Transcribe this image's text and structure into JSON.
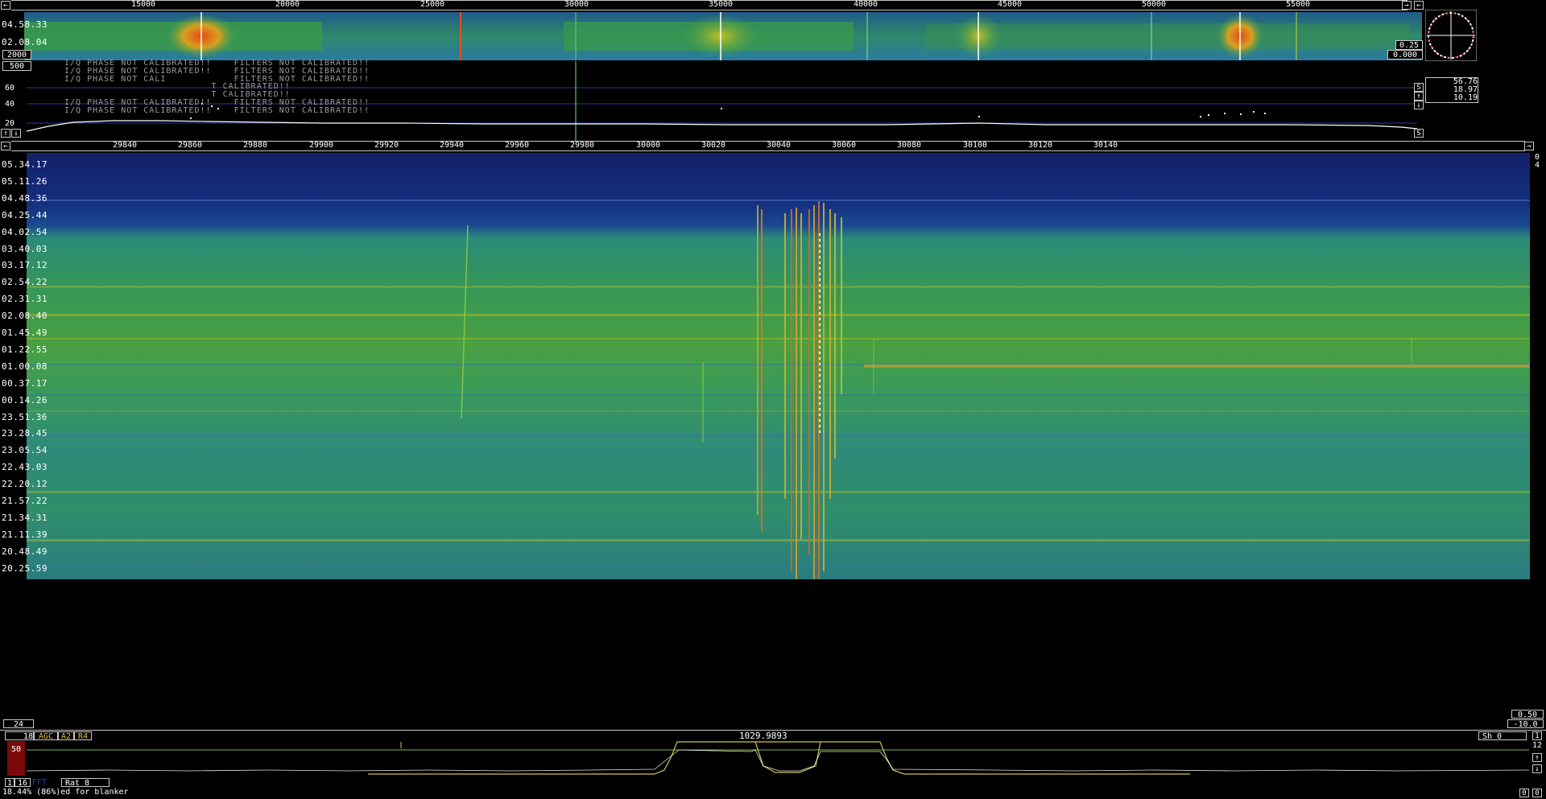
{
  "top_scale": {
    "ticks": [
      "15000",
      "20000",
      "25000",
      "30000",
      "35000",
      "40000",
      "45000",
      "50000",
      "55000"
    ]
  },
  "wide_waterfall": {
    "time_labels": [
      "04.58.33",
      "02.08.04"
    ],
    "left_value": "2000",
    "right_top": "0.25",
    "right_bottom": "0.000"
  },
  "spectrum": {
    "top_box": "500",
    "db_labels": [
      "60",
      "40",
      "20"
    ],
    "warnings": [
      "I/Q PHASE NOT CALIBRATED!!    FILTERS NOT CALIBRATED!!",
      "I/Q PHASE NOT CALIBRATED!!    FILTERS NOT CALIBRATED!!",
      "I/Q PHASE NOT CALI            FILTERS NOT CALIBRATED!!",
      "                          T CALIBRATED!!",
      "                          T CALIBRATED!!",
      "I/Q PHASE NOT CALIBRATED!!    FILTERS NOT CALIBRATED!!",
      "I/Q PHASE NOT CALIBRATED!!    FILTERS NOT CALIBRATED!!"
    ],
    "side_values": [
      "56.76",
      "18.97",
      "10.19"
    ],
    "side_buttons": [
      "S",
      "↑",
      "↓",
      "S"
    ]
  },
  "main_scale": {
    "ticks": [
      "29840",
      "29860",
      "29880",
      "29900",
      "29920",
      "29940",
      "29960",
      "29980",
      "30000",
      "30020",
      "30040",
      "30060",
      "30080",
      "30100",
      "30120",
      "30140"
    ]
  },
  "main_waterfall": {
    "time_labels": [
      "05.34.17",
      "05.11.26",
      "04.48.36",
      "04.25.44",
      "04.02.54",
      "03.40.03",
      "03.17.12",
      "02.54.22",
      "02.31.31",
      "02.08.40",
      "01.45.49",
      "01.22.55",
      "01.00.08",
      "00.37.17",
      "00.14.26",
      "23.51.36",
      "23.28.45",
      "23.05.54",
      "22.43.03",
      "22.20.12",
      "21.57.22",
      "21.34.31",
      "21.11.39",
      "20.48.49",
      "20.25.59"
    ],
    "right_top": "0",
    "right_second": "4"
  },
  "bottom_info": {
    "left_box": "24",
    "right_top": "0.50",
    "right_bottom": "-10.0"
  },
  "baseband": {
    "left_number": "18",
    "buttons": [
      "AGC",
      "A2",
      "R4"
    ],
    "level": "50",
    "freq_label": "1029.9893",
    "sh_label": "Sh   0",
    "right_nums": [
      "1",
      "12"
    ],
    "bottom_left_buttons": [
      "1",
      "16"
    ],
    "rat_label": "Rat  8",
    "fft_label": "FFT",
    "status": "18.44% (86%)ed for blanker",
    "bottom_right": [
      "0",
      "0"
    ]
  },
  "colors": {
    "grid": "#c8c8c8",
    "spectrum_line": "#ffffff",
    "filter_curve": "#d6c24a",
    "baseline": "#7bb84a"
  }
}
